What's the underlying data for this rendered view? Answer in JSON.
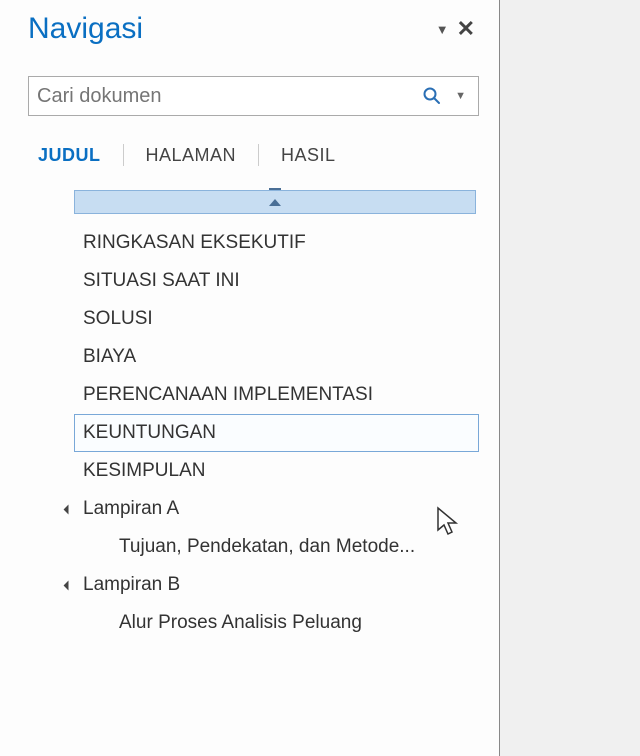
{
  "pane": {
    "title": "Navigasi"
  },
  "search": {
    "placeholder": "Cari dokumen"
  },
  "tabs": {
    "items": [
      "JUDUL",
      "HALAMAN",
      "HASIL"
    ],
    "active": "JUDUL"
  },
  "headings": [
    {
      "label": "RINGKASAN EKSEKUTIF",
      "level": 1,
      "expand": false,
      "selected": false
    },
    {
      "label": "SITUASI SAAT INI",
      "level": 1,
      "expand": false,
      "selected": false
    },
    {
      "label": "SOLUSI",
      "level": 1,
      "expand": false,
      "selected": false
    },
    {
      "label": "BIAYA",
      "level": 1,
      "expand": false,
      "selected": false
    },
    {
      "label": "PERENCANAAN IMPLEMENTASI",
      "level": 1,
      "expand": false,
      "selected": false
    },
    {
      "label": "KEUNTUNGAN",
      "level": 1,
      "expand": false,
      "selected": true
    },
    {
      "label": "KESIMPULAN",
      "level": 1,
      "expand": false,
      "selected": false
    },
    {
      "label": "Lampiran A",
      "level": 1,
      "expand": true,
      "selected": false
    },
    {
      "label": "Tujuan, Pendekatan, dan Metode...",
      "level": 2,
      "expand": false,
      "selected": false
    },
    {
      "label": "Lampiran B",
      "level": 1,
      "expand": true,
      "selected": false
    },
    {
      "label": "Alur Proses Analisis Peluang",
      "level": 2,
      "expand": false,
      "selected": false
    }
  ]
}
